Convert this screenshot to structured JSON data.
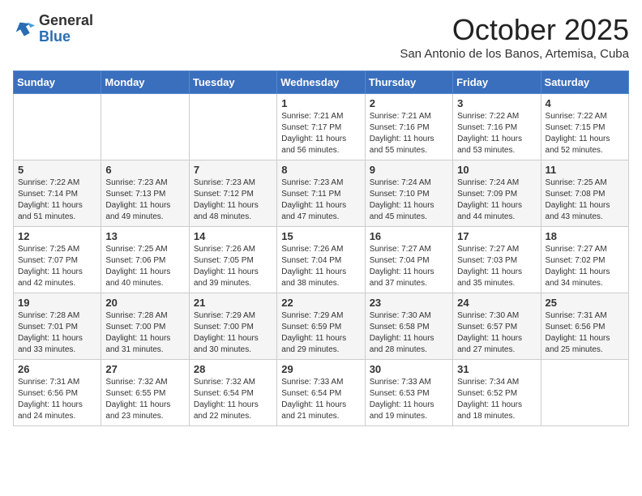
{
  "logo": {
    "general": "General",
    "blue": "Blue"
  },
  "header": {
    "month": "October 2025",
    "location": "San Antonio de los Banos, Artemisa, Cuba"
  },
  "weekdays": [
    "Sunday",
    "Monday",
    "Tuesday",
    "Wednesday",
    "Thursday",
    "Friday",
    "Saturday"
  ],
  "weeks": [
    [
      {
        "day": "",
        "info": ""
      },
      {
        "day": "",
        "info": ""
      },
      {
        "day": "",
        "info": ""
      },
      {
        "day": "1",
        "info": "Sunrise: 7:21 AM\nSunset: 7:17 PM\nDaylight: 11 hours and 56 minutes."
      },
      {
        "day": "2",
        "info": "Sunrise: 7:21 AM\nSunset: 7:16 PM\nDaylight: 11 hours and 55 minutes."
      },
      {
        "day": "3",
        "info": "Sunrise: 7:22 AM\nSunset: 7:16 PM\nDaylight: 11 hours and 53 minutes."
      },
      {
        "day": "4",
        "info": "Sunrise: 7:22 AM\nSunset: 7:15 PM\nDaylight: 11 hours and 52 minutes."
      }
    ],
    [
      {
        "day": "5",
        "info": "Sunrise: 7:22 AM\nSunset: 7:14 PM\nDaylight: 11 hours and 51 minutes."
      },
      {
        "day": "6",
        "info": "Sunrise: 7:23 AM\nSunset: 7:13 PM\nDaylight: 11 hours and 49 minutes."
      },
      {
        "day": "7",
        "info": "Sunrise: 7:23 AM\nSunset: 7:12 PM\nDaylight: 11 hours and 48 minutes."
      },
      {
        "day": "8",
        "info": "Sunrise: 7:23 AM\nSunset: 7:11 PM\nDaylight: 11 hours and 47 minutes."
      },
      {
        "day": "9",
        "info": "Sunrise: 7:24 AM\nSunset: 7:10 PM\nDaylight: 11 hours and 45 minutes."
      },
      {
        "day": "10",
        "info": "Sunrise: 7:24 AM\nSunset: 7:09 PM\nDaylight: 11 hours and 44 minutes."
      },
      {
        "day": "11",
        "info": "Sunrise: 7:25 AM\nSunset: 7:08 PM\nDaylight: 11 hours and 43 minutes."
      }
    ],
    [
      {
        "day": "12",
        "info": "Sunrise: 7:25 AM\nSunset: 7:07 PM\nDaylight: 11 hours and 42 minutes."
      },
      {
        "day": "13",
        "info": "Sunrise: 7:25 AM\nSunset: 7:06 PM\nDaylight: 11 hours and 40 minutes."
      },
      {
        "day": "14",
        "info": "Sunrise: 7:26 AM\nSunset: 7:05 PM\nDaylight: 11 hours and 39 minutes."
      },
      {
        "day": "15",
        "info": "Sunrise: 7:26 AM\nSunset: 7:04 PM\nDaylight: 11 hours and 38 minutes."
      },
      {
        "day": "16",
        "info": "Sunrise: 7:27 AM\nSunset: 7:04 PM\nDaylight: 11 hours and 37 minutes."
      },
      {
        "day": "17",
        "info": "Sunrise: 7:27 AM\nSunset: 7:03 PM\nDaylight: 11 hours and 35 minutes."
      },
      {
        "day": "18",
        "info": "Sunrise: 7:27 AM\nSunset: 7:02 PM\nDaylight: 11 hours and 34 minutes."
      }
    ],
    [
      {
        "day": "19",
        "info": "Sunrise: 7:28 AM\nSunset: 7:01 PM\nDaylight: 11 hours and 33 minutes."
      },
      {
        "day": "20",
        "info": "Sunrise: 7:28 AM\nSunset: 7:00 PM\nDaylight: 11 hours and 31 minutes."
      },
      {
        "day": "21",
        "info": "Sunrise: 7:29 AM\nSunset: 7:00 PM\nDaylight: 11 hours and 30 minutes."
      },
      {
        "day": "22",
        "info": "Sunrise: 7:29 AM\nSunset: 6:59 PM\nDaylight: 11 hours and 29 minutes."
      },
      {
        "day": "23",
        "info": "Sunrise: 7:30 AM\nSunset: 6:58 PM\nDaylight: 11 hours and 28 minutes."
      },
      {
        "day": "24",
        "info": "Sunrise: 7:30 AM\nSunset: 6:57 PM\nDaylight: 11 hours and 27 minutes."
      },
      {
        "day": "25",
        "info": "Sunrise: 7:31 AM\nSunset: 6:56 PM\nDaylight: 11 hours and 25 minutes."
      }
    ],
    [
      {
        "day": "26",
        "info": "Sunrise: 7:31 AM\nSunset: 6:56 PM\nDaylight: 11 hours and 24 minutes."
      },
      {
        "day": "27",
        "info": "Sunrise: 7:32 AM\nSunset: 6:55 PM\nDaylight: 11 hours and 23 minutes."
      },
      {
        "day": "28",
        "info": "Sunrise: 7:32 AM\nSunset: 6:54 PM\nDaylight: 11 hours and 22 minutes."
      },
      {
        "day": "29",
        "info": "Sunrise: 7:33 AM\nSunset: 6:54 PM\nDaylight: 11 hours and 21 minutes."
      },
      {
        "day": "30",
        "info": "Sunrise: 7:33 AM\nSunset: 6:53 PM\nDaylight: 11 hours and 19 minutes."
      },
      {
        "day": "31",
        "info": "Sunrise: 7:34 AM\nSunset: 6:52 PM\nDaylight: 11 hours and 18 minutes."
      },
      {
        "day": "",
        "info": ""
      }
    ]
  ]
}
